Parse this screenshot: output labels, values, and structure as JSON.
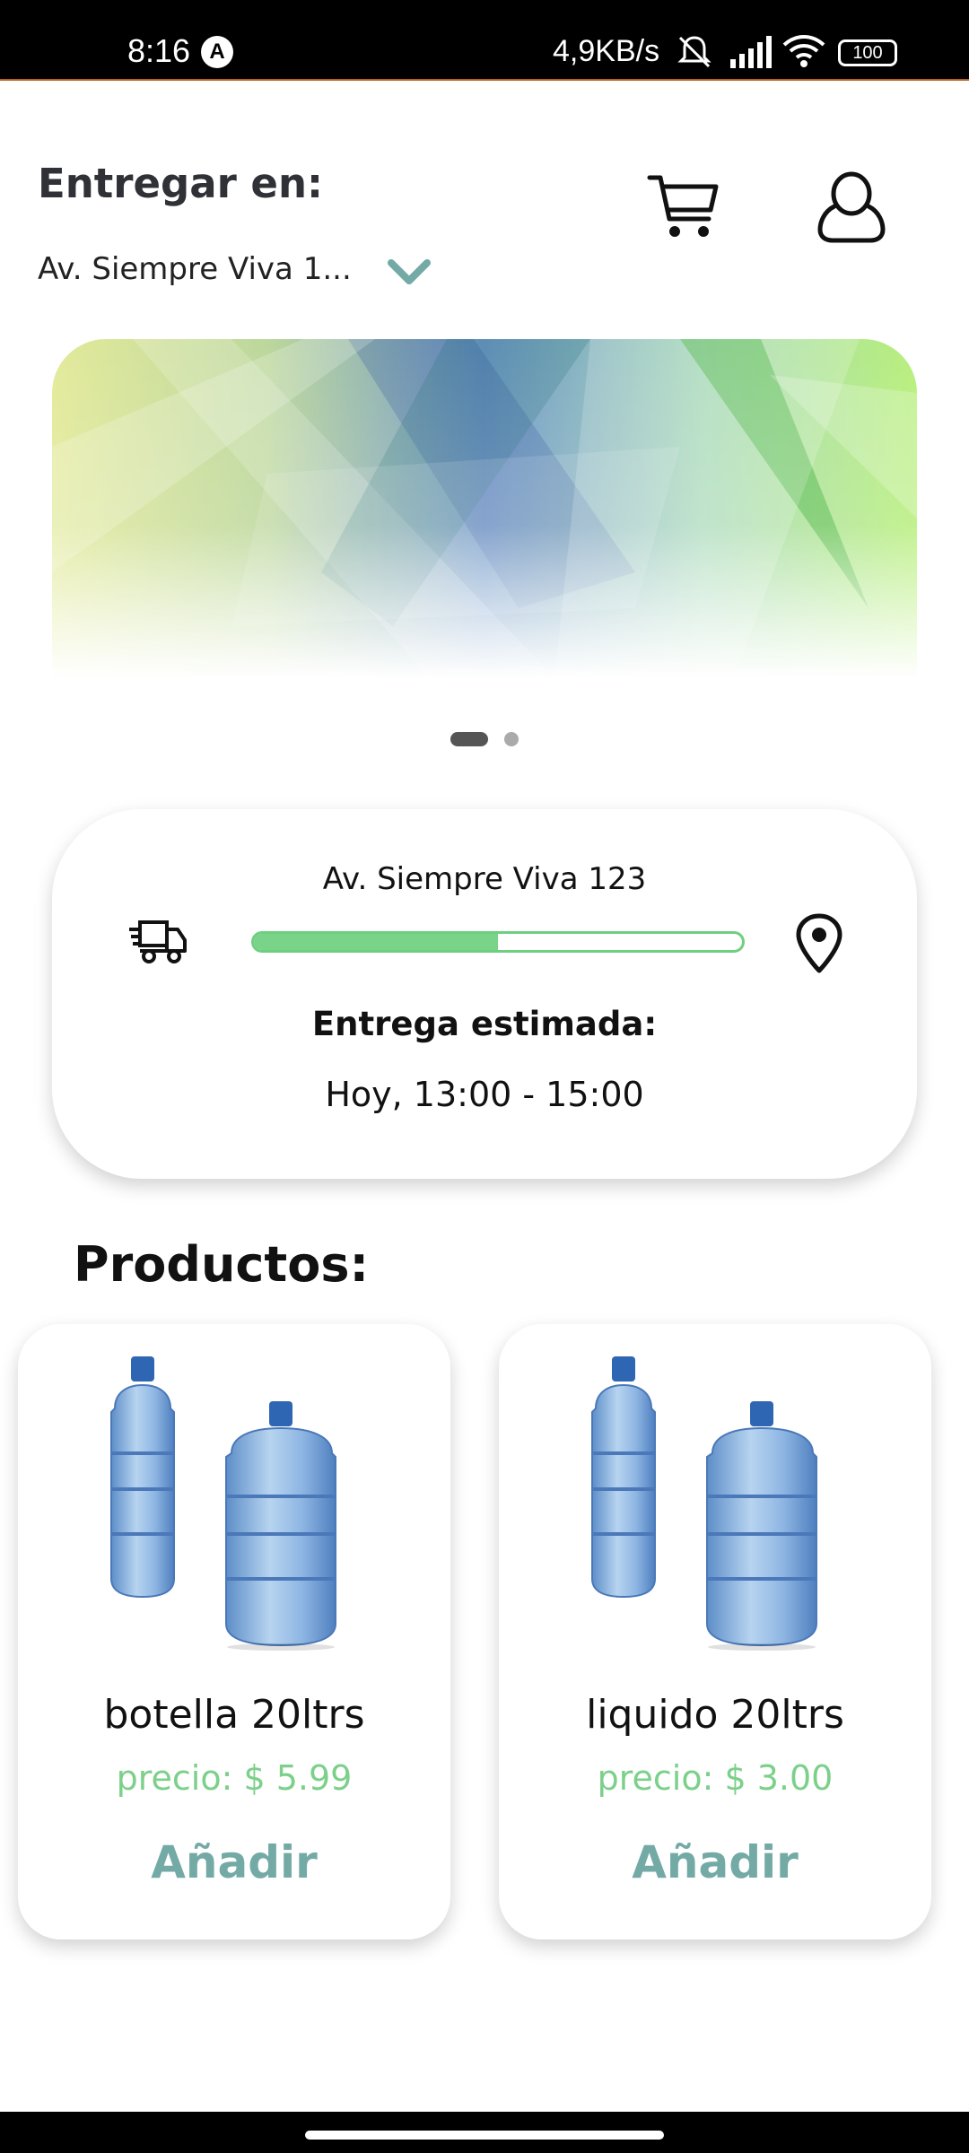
{
  "status_bar": {
    "time": "8:16",
    "app_badge": "A",
    "net_speed": "4,9KB/s",
    "battery": "100",
    "icons": [
      "mute-icon",
      "signal-icon",
      "wifi-icon",
      "battery-icon"
    ]
  },
  "header": {
    "title": "Entregar en:",
    "address_short": "Av. Siempre Viva 1...",
    "icons": [
      "chevron-down-icon",
      "cart-icon",
      "user-icon"
    ]
  },
  "banner": {
    "slides": 2,
    "active_slide": 1
  },
  "tracking": {
    "address": "Av. Siempre Viva 123",
    "progress": 0.5,
    "eta_label": "Entrega estimada:",
    "eta_value": "Hoy, 13:00 - 15:00",
    "icons": [
      "truck-icon",
      "location-pin-icon"
    ]
  },
  "products": {
    "title": "Productos:",
    "items": [
      {
        "name": "botella 20ltrs",
        "price": "precio: $ 5.99",
        "action": "Añadir"
      },
      {
        "name": "liquido 20ltrs",
        "price": "precio: $ 3.00",
        "action": "Añadir"
      }
    ]
  },
  "colors": {
    "accent_green": "#7cd08a",
    "accent_teal": "#74aaa6",
    "dark_text": "#2f3137"
  }
}
